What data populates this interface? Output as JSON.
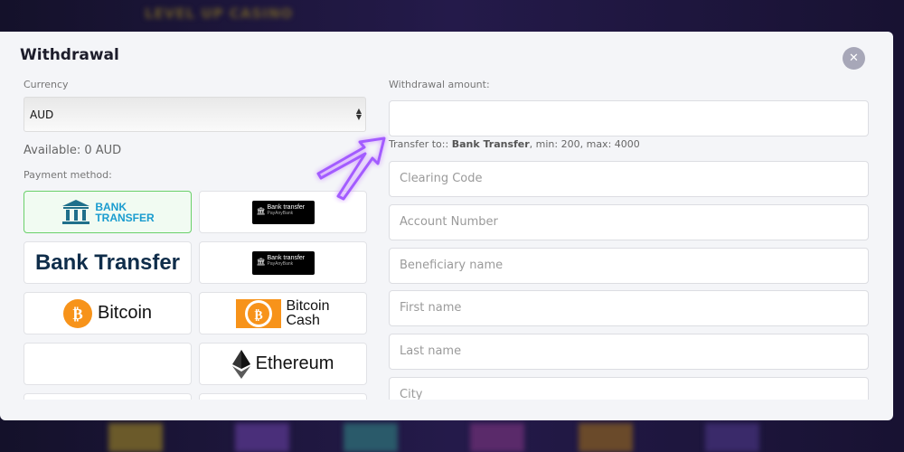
{
  "background": {
    "banner_text": "LEVEL UP CASINO"
  },
  "modal": {
    "title": "Withdrawal",
    "close_icon": "close-icon",
    "currency": {
      "label": "Currency",
      "selected": "AUD"
    },
    "available": "Available: 0 AUD",
    "payment_method_label": "Payment method:",
    "methods": [
      {
        "name": "BANK TRANSFER",
        "line1": "BANK",
        "line2": "TRANSFER",
        "selected": true
      },
      {
        "name": "Bank transfer PayAnyBank",
        "line1": "Bank transfer",
        "line2": "PayAnyBank"
      },
      {
        "name": "Bank Transfer",
        "line1": "Bank Transfer"
      },
      {
        "name": "Bank transfer PayAnyBank",
        "line1": "Bank transfer",
        "line2": "PayAnyBank"
      },
      {
        "name": "Bitcoin",
        "line1": "Bitcoin"
      },
      {
        "name": "Bitcoin Cash",
        "line1": "Bitcoin",
        "line2": "Cash"
      },
      {
        "name": "empty",
        "line1": ""
      },
      {
        "name": "Ethereum",
        "line1": "Ethereum"
      }
    ],
    "amount": {
      "label": "Withdrawal amount:",
      "value": ""
    },
    "hint": {
      "prefix": "Transfer to:: ",
      "method": "Bank Transfer",
      "suffix": ", min: 200, max: 4000"
    },
    "fields": [
      {
        "placeholder": "Clearing Code"
      },
      {
        "placeholder": "Account Number"
      },
      {
        "placeholder": "Beneficiary name"
      },
      {
        "placeholder": "First name"
      },
      {
        "placeholder": "Last name"
      },
      {
        "placeholder": "City"
      }
    ]
  },
  "colors": {
    "selected_border": "#6ad06a",
    "bitcoin": "#f7931a",
    "bank_blue": "#1a9ccf",
    "bank_navy": "#0f2d4a",
    "arrow": "#9b4dff"
  }
}
